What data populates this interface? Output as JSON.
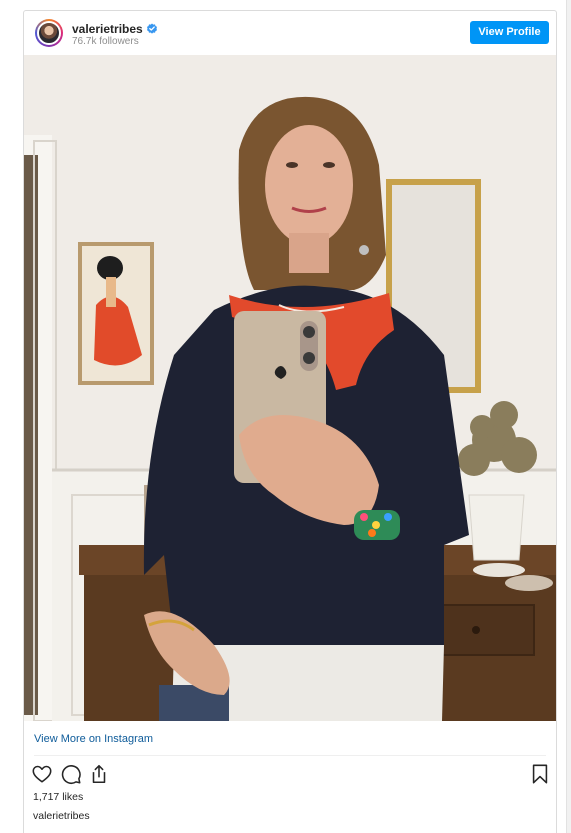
{
  "post": {
    "username": "valerietribes",
    "followers": "76.7k followers",
    "view_profile_label": "View Profile",
    "view_more_label": "View More on Instagram",
    "likes": "1,717 likes",
    "caption_username": "valerietribes"
  },
  "icons": {
    "verified": "verified-badge-icon",
    "like": "heart-icon",
    "comment": "comment-icon",
    "share": "share-icon",
    "save": "bookmark-icon"
  },
  "colors": {
    "accent": "#0095f6",
    "link": "#0f5c9a",
    "text": "#262626",
    "muted": "#8e8e8e"
  }
}
